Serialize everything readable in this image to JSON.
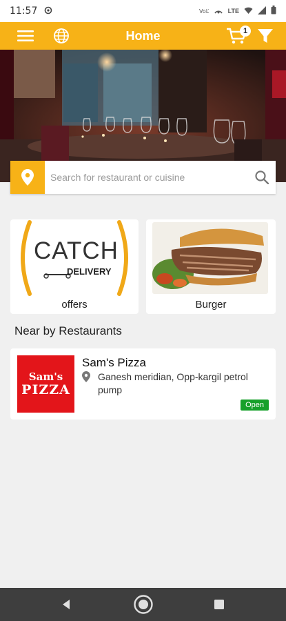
{
  "status_bar": {
    "time": "11:57",
    "network_label": "LTE"
  },
  "app_bar": {
    "title": "Home",
    "cart_count": "1"
  },
  "search": {
    "placeholder": "Search for restaurant or cuisine"
  },
  "categories": [
    {
      "label": "offers",
      "logo_text_main": "CATCH",
      "logo_text_sub": "DELIVERY"
    },
    {
      "label": "Burger"
    }
  ],
  "nearby": {
    "title": "Near by Restaurants",
    "restaurants": [
      {
        "name": "Sam's Pizza",
        "address": "Ganesh meridian, Opp-kargil petrol pump",
        "status": "Open",
        "logo_line1": "Sam's",
        "logo_line2": "PIZZA"
      }
    ]
  },
  "colors": {
    "accent": "#f7b217",
    "open_badge": "#16a02a",
    "logo_red": "#e3151a"
  }
}
